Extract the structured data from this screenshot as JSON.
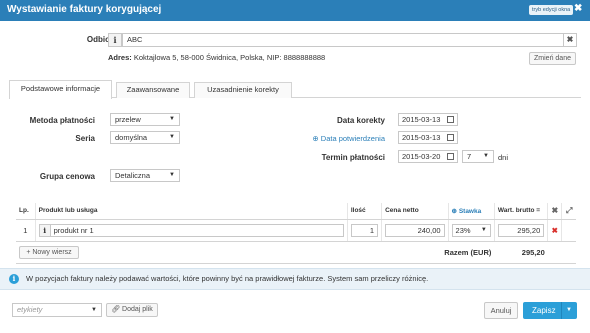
{
  "window": {
    "title": "Wystawianie faktury korygującej",
    "mode_button": "tryb edycji okna",
    "close_glyph": "✖"
  },
  "recipient": {
    "label": "Odbiorca",
    "info_glyph": "i",
    "value": "ABC",
    "clear_glyph": "✖",
    "address_label": "Adres:",
    "address": "Koktajlowa 5, 58-000 Świdnica, Polska, NIP: 8888888888",
    "change_button": "Zmień dane"
  },
  "tabs": [
    {
      "label": "Podstawowe informacje",
      "active": true
    },
    {
      "label": "Zaawansowane",
      "active": false
    },
    {
      "label": "Uzasadnienie korekty",
      "active": false
    }
  ],
  "form": {
    "payment_method_label": "Metoda płatności",
    "payment_method_value": "przelew",
    "series_label": "Seria",
    "series_value": "domyślna",
    "price_group_label": "Grupa cenowa",
    "price_group_value": "Detaliczna",
    "correction_date_label": "Data korekty",
    "correction_date_value": "2015-03-13",
    "confirmation_date_label": "Data potwierdzenia",
    "confirmation_date_value": "2015-03-13",
    "payment_term_label": "Termin płatności",
    "payment_term_value": "2015-03-20",
    "payment_days_value": "7",
    "days_unit": "dni"
  },
  "table": {
    "headers": {
      "lp": "Lp.",
      "product": "Produkt lub usługa",
      "qty": "Ilość",
      "net_price": "Cena netto",
      "rate": "Stawka",
      "gross": "Wart. brutto ="
    },
    "rows": [
      {
        "lp": "1",
        "product": "produkt nr 1",
        "qty": "1",
        "net_price": "240,00",
        "rate": "23%",
        "gross": "295,20"
      }
    ],
    "add_row_button": "Nowy wiersz",
    "total_label": "Razem (EUR)",
    "total_value": "295,20"
  },
  "info_message": "W pozycjach faktury należy podawać wartości, które powinny być na prawidłowej fakturze. System sam przeliczy różnicę.",
  "footer": {
    "tags_placeholder": "etykiety",
    "attach_button": "Dodaj plik",
    "cancel_button": "Anuluj",
    "save_button": "Zapisz"
  },
  "colors": {
    "titlebar": "#2b7fb8",
    "primary": "#2b9fd8",
    "info_bar": "#eaf2f8",
    "delete": "#d9302c"
  }
}
